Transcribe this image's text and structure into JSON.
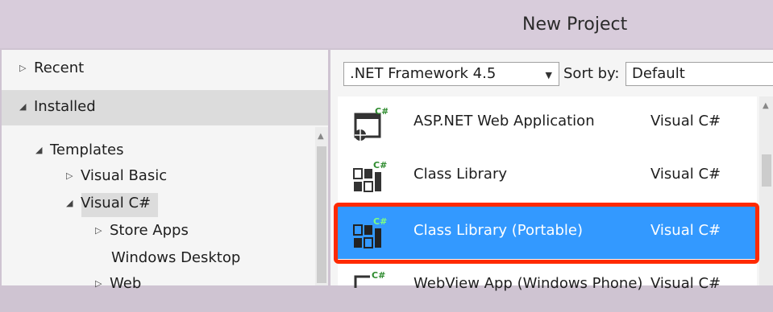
{
  "window": {
    "title": "New Project"
  },
  "tree": {
    "recent": "Recent",
    "installed": "Installed",
    "templates": "Templates",
    "visual_basic": "Visual Basic",
    "visual_csharp": "Visual C#",
    "store_apps": "Store Apps",
    "windows_desktop": "Windows Desktop",
    "web": "Web"
  },
  "toolbar": {
    "framework": ".NET Framework 4.5",
    "sort_label": "Sort by:",
    "sort_value": "Default"
  },
  "templates": [
    {
      "name": "ASP.NET Web Application",
      "language": "Visual C#"
    },
    {
      "name": "Class Library",
      "language": "Visual C#"
    },
    {
      "name": "Class Library (Portable)",
      "language": "Visual C#",
      "selected": true
    },
    {
      "name": "WebView App (Windows Phone)",
      "language": "Visual C#"
    }
  ],
  "colors": {
    "selection": "#3399ff",
    "highlight": "#ff2a00"
  }
}
